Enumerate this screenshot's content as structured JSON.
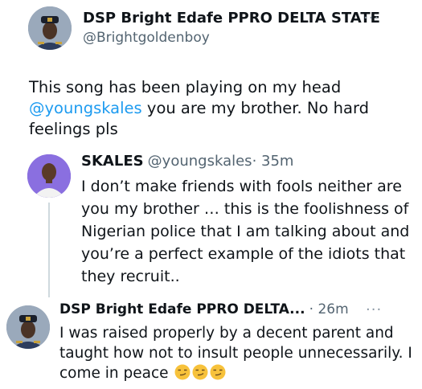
{
  "tweet1": {
    "name": "DSP Bright Edafe PPRO DELTA STATE",
    "handle": "@Brightgoldenboy",
    "more": "···",
    "text_part1": "This song has been playing on my head",
    "mention": "@youngskales",
    "text_part2": " you are my brother. No hard feelings pls"
  },
  "tweet2": {
    "name": "SKALES",
    "handle": "@youngskales",
    "time": "· 35m",
    "text": "I don’t make friends with fools neither are you my brother … this is the foolishness of Nigerian police that I am talking about and you’re a perfect example of the idiots that they recruit.."
  },
  "tweet3": {
    "name": "DSP Bright Edafe PPRO DELTA...",
    "time": "· 26m",
    "more": "···",
    "text": "I was raised properly by a decent parent and taught how not to insult people unnecessarily. I come in peace",
    "emojis": [
      "smirk-emoji",
      "smirk-emoji",
      "smirk-emoji"
    ]
  }
}
